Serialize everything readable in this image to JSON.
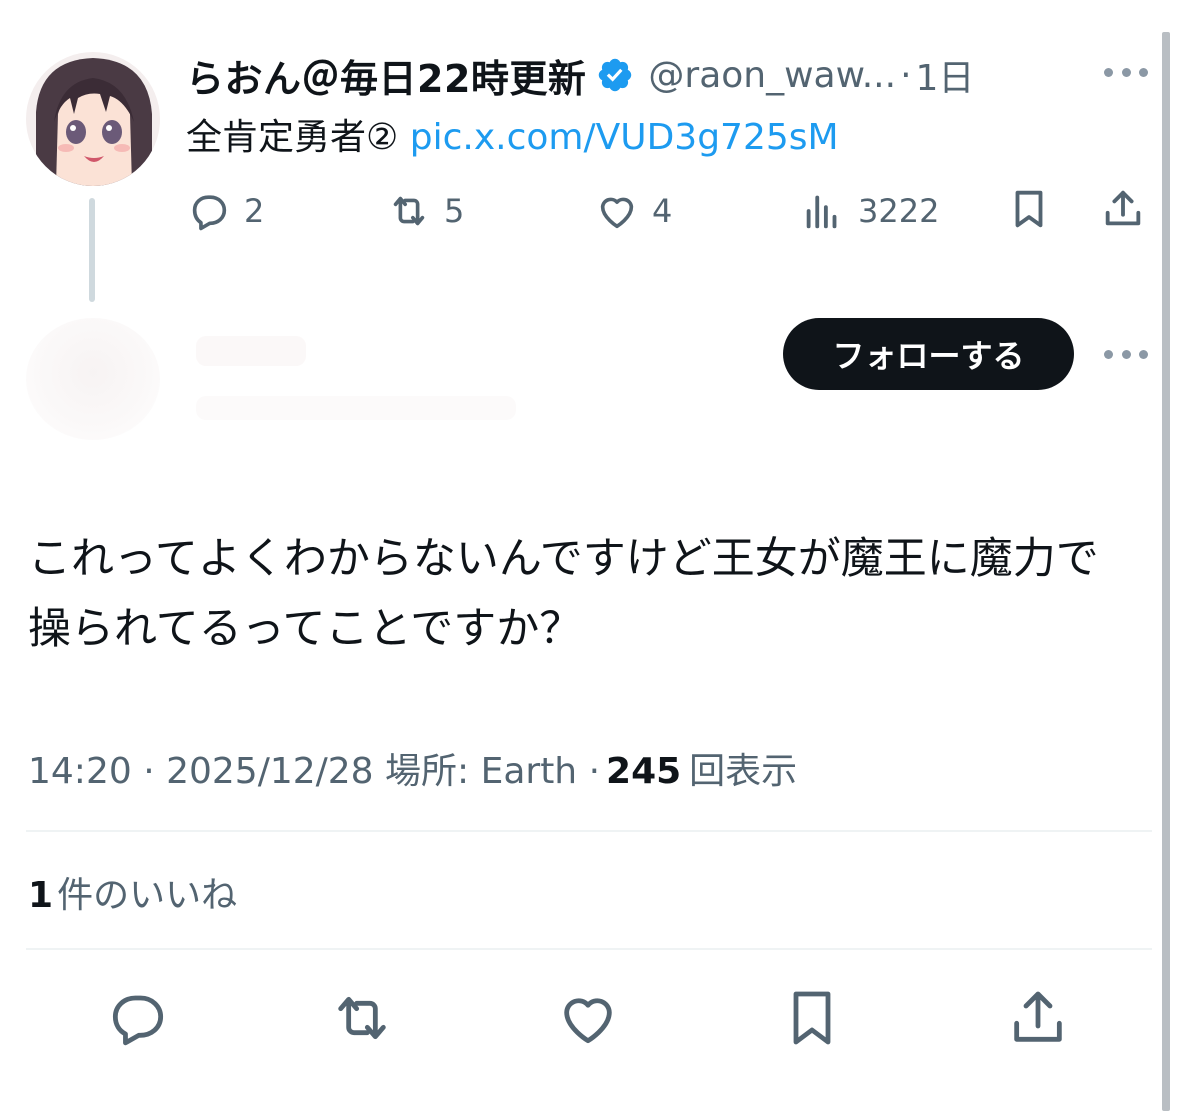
{
  "parent_tweet": {
    "author_name": "らおん＠毎日22時更新",
    "handle": "@raon_waw...",
    "separator": "·",
    "time_ago": "1日",
    "text": "全肯定勇者②",
    "link": "pic.x.com/VUD3g725sM",
    "replies": "2",
    "retweets": "5",
    "likes": "4",
    "views": "3222"
  },
  "reply_tweet": {
    "follow_label": "フォローする",
    "text": "これってよくわからないんですけど王女が魔王に魔力で操られてるってことですか？",
    "meta_time": "14:20 · 2025/12/28 場所: Earth ·",
    "views_count": "245",
    "views_label": "回表示",
    "likes_count": "1",
    "likes_label": "件のいいね"
  },
  "colors": {
    "text_primary": "#0f1419",
    "text_secondary": "#536471",
    "link": "#1d9bf0",
    "verified": "#1d9bf0",
    "follow_button_bg": "#0f1419"
  }
}
